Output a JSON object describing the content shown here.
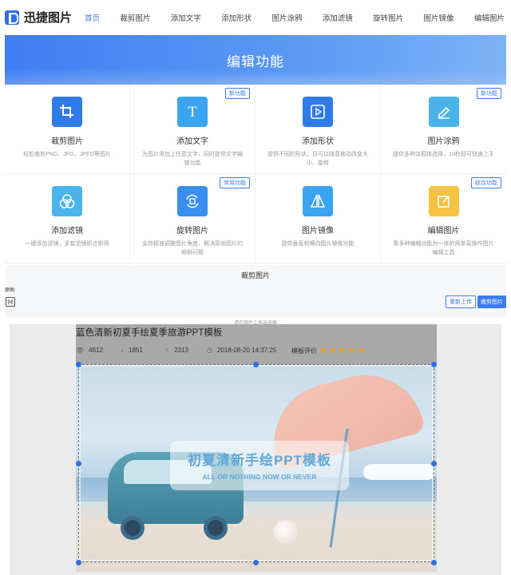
{
  "nav": {
    "logo_text": "迅捷图片",
    "items": [
      "首页",
      "裁剪图片",
      "添加文字",
      "添加形状",
      "图片涂鸦",
      "添加滤镜",
      "旋转图片",
      "图片镜像",
      "编辑图片"
    ],
    "active_index": 0
  },
  "banner": {
    "title": "编辑功能"
  },
  "features": [
    {
      "title": "裁剪图片",
      "desc": "轻松裁剪PNG、JPG、JPEG等图片",
      "badge": "",
      "color": "#2f7be8",
      "icon": "crop-icon"
    },
    {
      "title": "添加文字",
      "desc": "为图片添加上任意文字，同时提供文字编辑功能",
      "badge": "新功能",
      "color": "#3aa4f0",
      "icon": "text-icon"
    },
    {
      "title": "添加形状",
      "desc": "提供不同的形状，且可以随意拖动改变大小、旋转",
      "badge": "",
      "color": "#2f7be8",
      "icon": "shape-icon"
    },
    {
      "title": "图片涂鸦",
      "desc": "提供多种涂鸦体选择，10秒即可快速上手",
      "badge": "新功能",
      "color": "#4ab3ea",
      "icon": "pen-icon"
    },
    {
      "title": "添加滤镜",
      "desc": "一键添加滤镜，多套滤镜即点即用",
      "badge": "",
      "color": "#4ab3ea",
      "icon": "filter-icon"
    },
    {
      "title": "旋转图片",
      "desc": "支持精准调整图片角度，解决原始图片的倾斜问题",
      "badge": "常用功能",
      "color": "#3a8ef0",
      "icon": "rotate-icon"
    },
    {
      "title": "图片镜像",
      "desc": "提供垂直和横向图片镜像功能",
      "badge": "",
      "color": "#3aa4f0",
      "icon": "mirror-icon"
    },
    {
      "title": "编辑图片",
      "desc": "集多种编辑功能为一体的简单易操作图片编辑工具",
      "badge": "综合功能",
      "color": "#f5c242",
      "icon": "edit-icon"
    }
  ],
  "tool": {
    "title": "裁剪图片",
    "ratio_label": "原图",
    "reupload_label": "重新上传",
    "crop_label": "裁剪图片",
    "drag_hint": "请在图片上拖出选框"
  },
  "photo": {
    "title": "蓝色清新初夏手绘夏季旅游PPT模板",
    "views": "4612",
    "downloads": "1851",
    "favorites": "2313",
    "datetime": "2018-08-20 14:37:25",
    "rating_label": "模板评价",
    "rating": 5,
    "overlay_title": "初夏清新手绘PPT模板",
    "overlay_sub": "ALL OR NOTHING NOW OR NEVER"
  }
}
